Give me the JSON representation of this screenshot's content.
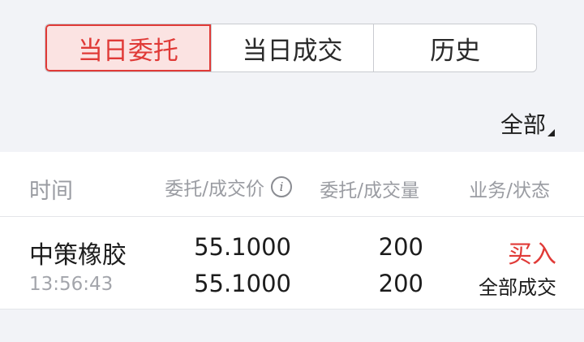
{
  "tabs": [
    {
      "label": "当日委托",
      "active": true
    },
    {
      "label": "当日成交",
      "active": false
    },
    {
      "label": "历史",
      "active": false
    }
  ],
  "filter": {
    "label": "全部"
  },
  "table": {
    "headers": {
      "time": "时间",
      "price": "委托/成交价",
      "quantity": "委托/成交量",
      "status": "业务/状态"
    },
    "rows": [
      {
        "name": "中策橡胶",
        "time": "13:56:43",
        "order_price": "55.1000",
        "deal_price": "55.1000",
        "order_qty": "200",
        "deal_qty": "200",
        "side": "买入",
        "status": "全部成交"
      }
    ]
  },
  "icons": {
    "price_info": "info-icon",
    "filter_dropdown": "corner-triangle-icon"
  },
  "colors": {
    "accent": "#e03a37",
    "active_tab_bg": "#fbe3e2",
    "page_bg": "#f2f3f7",
    "muted_text": "#9a9ca2"
  }
}
